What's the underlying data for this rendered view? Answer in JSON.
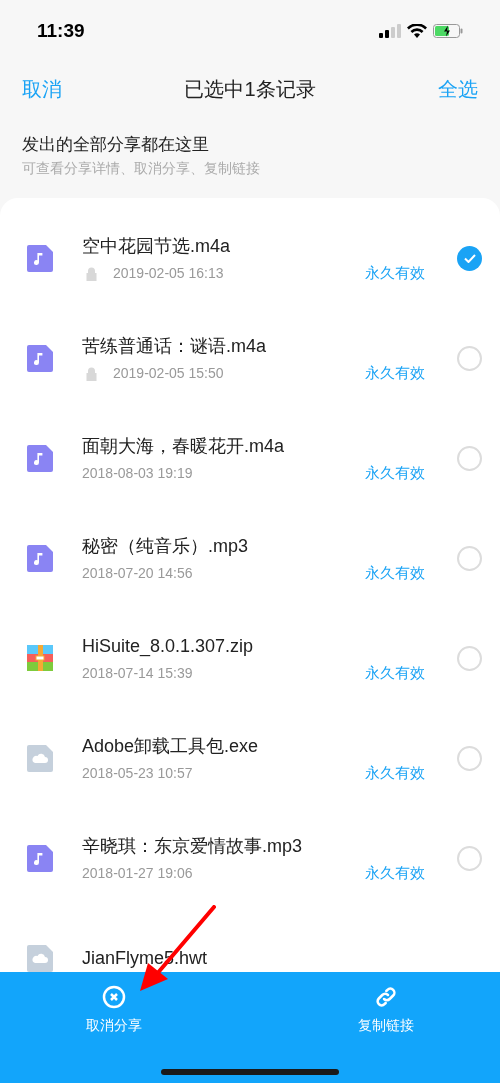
{
  "status_bar": {
    "time": "11:39"
  },
  "nav": {
    "cancel": "取消",
    "title": "已选中1条记录",
    "select_all": "全选"
  },
  "header": {
    "title": "发出的全部分享都在这里",
    "subtitle": "可查看分享详情、取消分享、复制链接"
  },
  "files": [
    {
      "kind": "audio",
      "name": "空中花园节选.m4a",
      "locked": true,
      "date": "2019-02-05 16:13",
      "validity": "永久有效",
      "selected": true
    },
    {
      "kind": "audio",
      "name": "苦练普通话：谜语.m4a",
      "locked": true,
      "date": "2019-02-05 15:50",
      "validity": "永久有效",
      "selected": false
    },
    {
      "kind": "audio",
      "name": "面朝大海，春暖花开.m4a",
      "locked": false,
      "date": "2018-08-03 19:19",
      "validity": "永久有效",
      "selected": false
    },
    {
      "kind": "audio",
      "name": "秘密（纯音乐）.mp3",
      "locked": false,
      "date": "2018-07-20 14:56",
      "validity": "永久有效",
      "selected": false
    },
    {
      "kind": "archive",
      "name": "HiSuite_8.0.1.307.zip",
      "locked": false,
      "date": "2018-07-14 15:39",
      "validity": "永久有效",
      "selected": false
    },
    {
      "kind": "cloud",
      "name": "Adobe卸载工具包.exe",
      "locked": false,
      "date": "2018-05-23 10:57",
      "validity": "永久有效",
      "selected": false
    },
    {
      "kind": "audio",
      "name": "辛晓琪：东京爱情故事.mp3",
      "locked": false,
      "date": "2018-01-27 19:06",
      "validity": "永久有效",
      "selected": false
    },
    {
      "kind": "cloud",
      "name": "JianFlyme5.hwt"
    }
  ],
  "bottom_bar": [
    {
      "kind": "cancel",
      "label": "取消分享"
    },
    {
      "kind": "link",
      "label": "复制链接"
    }
  ]
}
